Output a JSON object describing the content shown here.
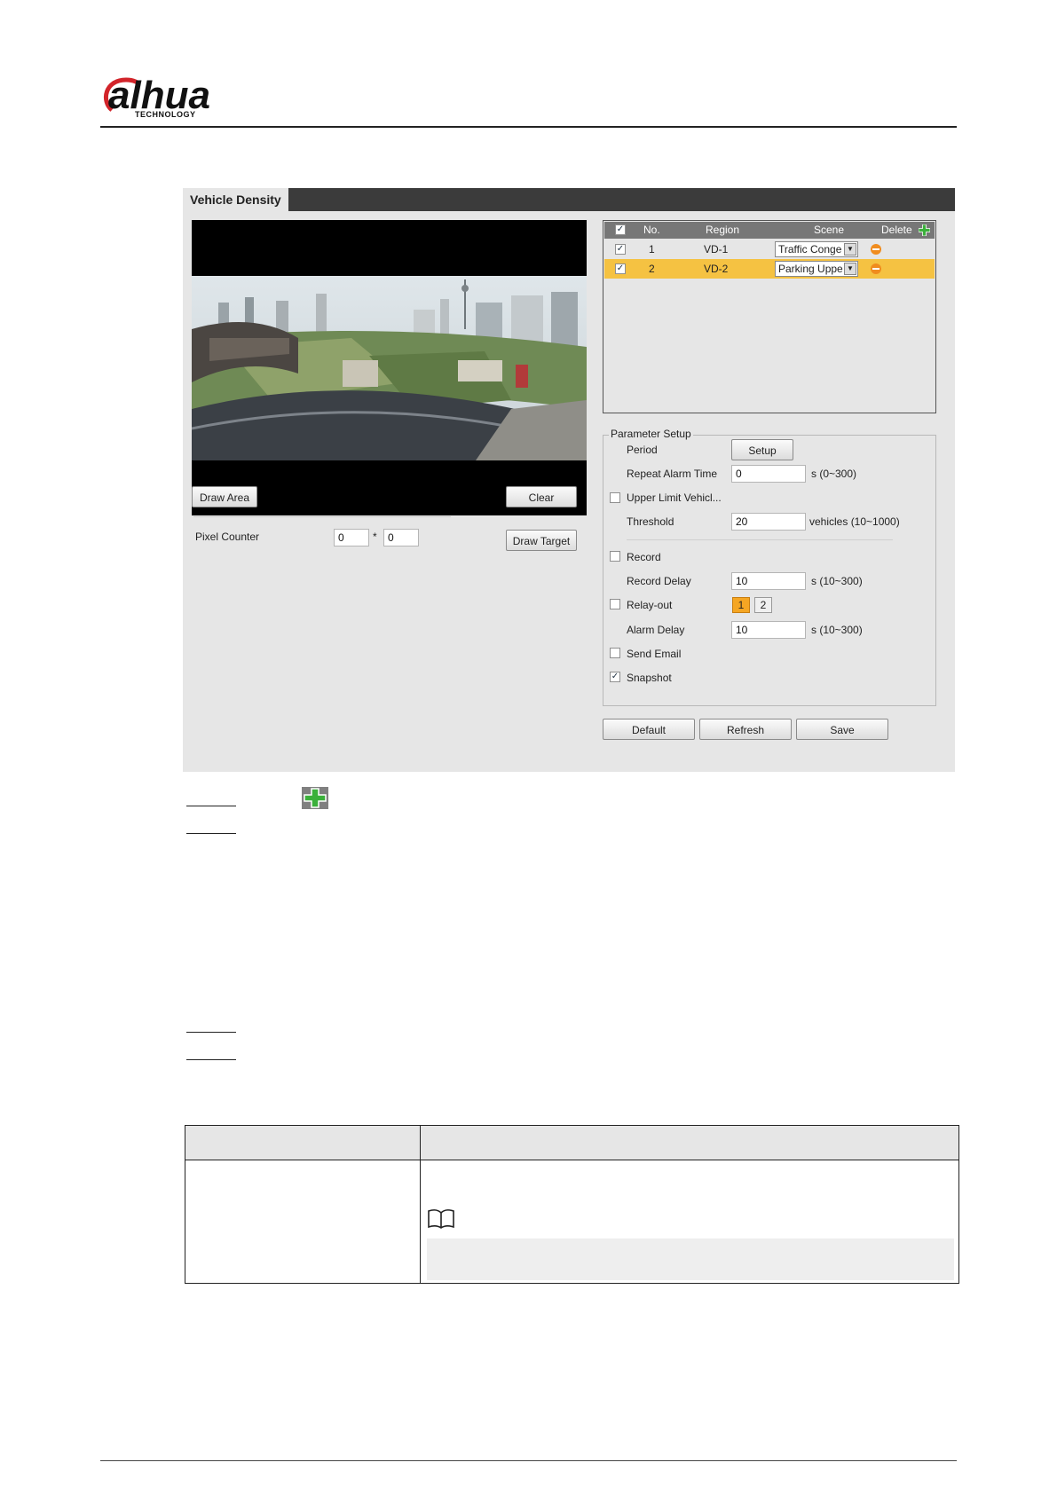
{
  "header": {
    "brand": "alhua",
    "brand_sub": "TECHNOLOGY"
  },
  "panel": {
    "title": "Vehicle Density",
    "left": {
      "draw_area_label": "Draw Area",
      "clear_label": "Clear",
      "pixel_counter_label": "Pixel Counter",
      "pixel_w": "0",
      "pixel_sep": "*",
      "pixel_h": "0",
      "draw_target_label": "Draw Target"
    },
    "rules": {
      "columns": [
        "No.",
        "Region",
        "Scene",
        "Delete"
      ],
      "rows": [
        {
          "no": "1",
          "region": "VD-1",
          "scene": "Traffic Conge",
          "checked": true,
          "selected": false
        },
        {
          "no": "2",
          "region": "VD-2",
          "scene": "Parking Uppe",
          "checked": true,
          "selected": true
        }
      ]
    },
    "params": {
      "legend": "Parameter Setup",
      "period_label": "Period",
      "setup_label": "Setup",
      "repeat_alarm_label": "Repeat Alarm Time",
      "repeat_alarm_value": "0",
      "repeat_alarm_unit": "s (0~300)",
      "upper_limit_label": "Upper Limit Vehicl...",
      "threshold_label": "Threshold",
      "threshold_value": "20",
      "threshold_unit": "vehicles (10~1000)",
      "record_label": "Record",
      "record_delay_label": "Record Delay",
      "record_delay_value": "10",
      "record_delay_unit": "s (10~300)",
      "relay_out_label": "Relay-out",
      "relay_1": "1",
      "relay_2": "2",
      "alarm_delay_label": "Alarm Delay",
      "alarm_delay_value": "10",
      "alarm_delay_unit": "s (10~300)",
      "send_email_label": "Send Email",
      "snapshot_label": "Snapshot"
    },
    "footer_buttons": {
      "default_label": "Default",
      "refresh_label": "Refresh",
      "save_label": "Save"
    }
  },
  "colors": {
    "selected_row": "#f5c242",
    "delete_icon": "#f08c1e",
    "add_icon": "#3bb03b",
    "titlebar": "#3b3b3b"
  }
}
